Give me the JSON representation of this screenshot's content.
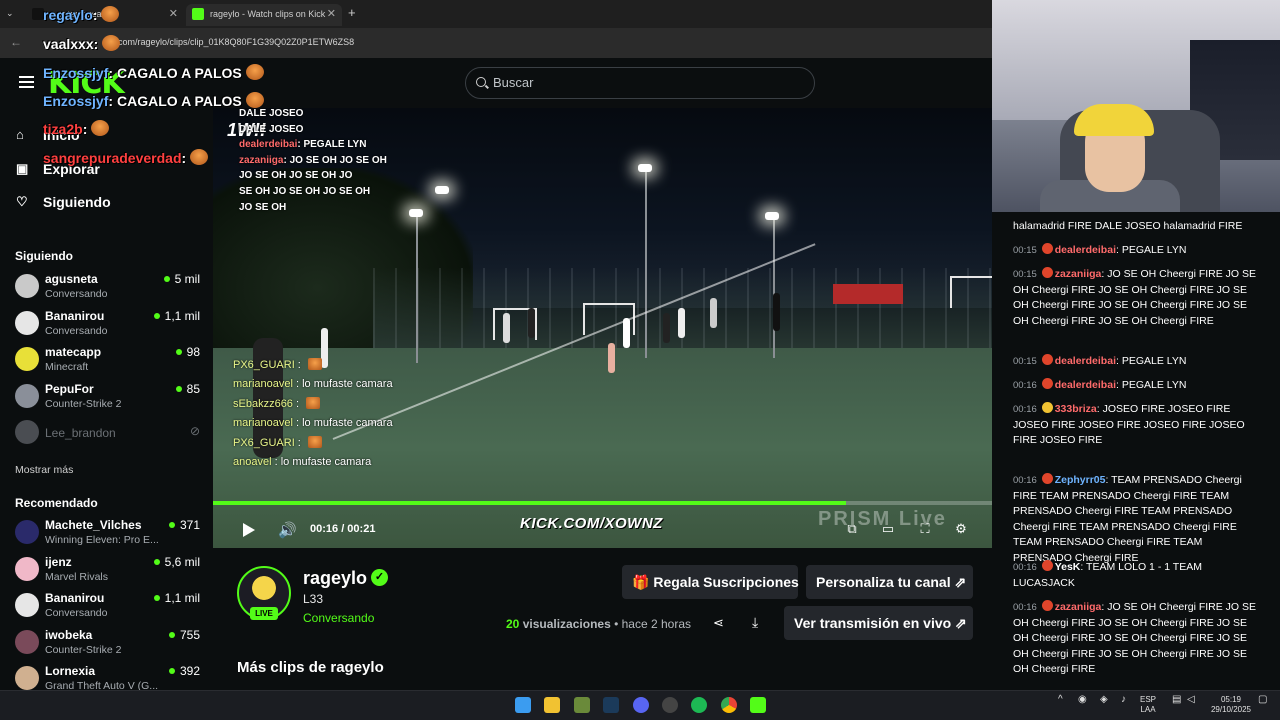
{
  "browser": {
    "tabs": [
      {
        "label": "...antes pesad",
        "active": false
      },
      {
        "label": "rageylo - Watch clips on Kick",
        "active": true
      }
    ],
    "new_tab": "+",
    "url": "com/rageylo/clips/clip_01K8Q80F1G39Q02Z0P1ETW6ZS8"
  },
  "header": {
    "logo": "KICK",
    "search_placeholder": "Buscar"
  },
  "overlay_chat": [
    {
      "user": "regaylo",
      "text": "",
      "color": "#6fb4ff"
    },
    {
      "user": "vaalxxx",
      "text": "",
      "color": "#ffffff"
    },
    {
      "user": "Enzossjyf",
      "text": "CAGALO A PALOS",
      "color": "#6fb4ff"
    },
    {
      "user": "Enzossjyf",
      "text": "CAGALO A PALOS",
      "color": "#6fb4ff"
    },
    {
      "user": "tiza2b",
      "text": "",
      "color": "#ff4040"
    },
    {
      "user": "sangrepuradeverdad",
      "text": "",
      "color": "#ff4040"
    }
  ],
  "sidebar": {
    "nav": [
      {
        "label": "Inicio",
        "icon": "home-icon"
      },
      {
        "label": "Explorar",
        "icon": "compass-icon"
      },
      {
        "label": "Siguiendo",
        "icon": "heart-icon"
      }
    ],
    "following_title": "Siguiendo",
    "following": [
      {
        "name": "agusneta",
        "game": "Conversando",
        "viewers": "5 mil",
        "avatar_color": "#c9c9c9"
      },
      {
        "name": "Bananirou",
        "game": "Conversando",
        "viewers": "1,1 mil",
        "avatar_color": "#e6e6e6"
      },
      {
        "name": "matecapp",
        "game": "Minecraft",
        "viewers": "98",
        "avatar_color": "#e8e038"
      },
      {
        "name": "PepuFor",
        "game": "Counter-Strike 2",
        "viewers": "85",
        "avatar_color": "#8a8f99"
      },
      {
        "name": "Lee_brandon",
        "game": "",
        "viewers": "",
        "avatar_color": "#4a4d52",
        "offline": true
      }
    ],
    "show_more": "Mostrar más",
    "recommended_title": "Recomendado",
    "recommended": [
      {
        "name": "Machete_Vilches",
        "game": "Winning Eleven: Pro E...",
        "viewers": "371",
        "avatar_color": "#2a2a6a"
      },
      {
        "name": "ijenz",
        "game": "Marvel Rivals",
        "viewers": "5,6 mil",
        "avatar_color": "#f0b8c8"
      },
      {
        "name": "Bananirou",
        "game": "Conversando",
        "viewers": "1,1 mil",
        "avatar_color": "#e6e6e6"
      },
      {
        "name": "iwobeka",
        "game": "Counter-Strike 2",
        "viewers": "755",
        "avatar_color": "#7a4a5a"
      },
      {
        "name": "Lornexia",
        "game": "Grand Theft Auto V (G...",
        "viewers": "392",
        "avatar_color": "#d0b090"
      }
    ]
  },
  "video": {
    "time": "00:16 / 00:21",
    "progress": 0.813,
    "watermark": "KICK.COM/XOWNZ",
    "prism": "PRISM Live",
    "stream_chat_top": [
      {
        "user": "",
        "text": "DALE JOSEO"
      },
      {
        "user": "",
        "text": "DALE JOSEO"
      },
      {
        "user": "dealerdeibai",
        "text": "PEGALE LYN"
      },
      {
        "user": "zazaniiga",
        "text": "JO SE OH   JO SE OH"
      },
      {
        "user": "",
        "text": "JO SE OH   JO SE OH   JO"
      },
      {
        "user": "",
        "text": "SE OH   JO SE OH   JO SE OH"
      },
      {
        "user": "",
        "text": "JO SE OH"
      }
    ],
    "stream_chat_bottom": [
      {
        "user": "PX6_GUARI",
        "text": ""
      },
      {
        "user": "marianoavel",
        "text": "lo mufaste camara"
      },
      {
        "user": "sEbakzz666",
        "text": ""
      },
      {
        "user": "marianoavel",
        "text": "lo mufaste camara"
      },
      {
        "user": "PX6_GUARI",
        "text": ""
      },
      {
        "user": "anoavel",
        "text": "lo mufaste camara"
      }
    ]
  },
  "clip": {
    "channel": "rageylo",
    "live_badge": "LIVE",
    "title": "L33",
    "category": "Conversando",
    "views_count": "20",
    "views_label": "visualizaciones",
    "time_ago": "• hace 2 horas",
    "btn_gift": "Regala Suscripciones",
    "btn_customize": "Personaliza tu canal",
    "btn_watch_live": "Ver transmisión en vivo",
    "more_clips": "Más clips de rageylo"
  },
  "chat": [
    {
      "time": "",
      "user": "",
      "text": "halamadrid FIRE DALE JOSEO halamadrid FIRE",
      "ucolor": "#ffffff"
    },
    {
      "time": "00:15",
      "user": "dealerdeibai",
      "text": "PEGALE LYN",
      "ucolor": "#ff6b6b"
    },
    {
      "time": "00:15",
      "user": "zazaniiga",
      "text": "JO SE OH Cheergi FIRE JO SE OH Cheergi FIRE JO SE OH Cheergi FIRE JO SE OH Cheergi FIRE JO SE OH Cheergi FIRE JO SE OH Cheergi FIRE JO SE OH Cheergi FIRE",
      "ucolor": "#ff6b6b"
    },
    {
      "time": "00:15",
      "user": "dealerdeibai",
      "text": "PEGALE LYN",
      "ucolor": "#ff6b6b"
    },
    {
      "time": "00:16",
      "user": "dealerdeibai",
      "text": "PEGALE LYN",
      "ucolor": "#ff6b6b"
    },
    {
      "time": "00:16",
      "user": "333briza",
      "text": "JOSEO   FIRE JOSEO   FIRE JOSEO   FIRE JOSEO   FIRE JOSEO   FIRE JOSEO   FIRE JOSEO   FIRE",
      "ucolor": "#ff6b6b"
    },
    {
      "time": "00:16",
      "user": "Zephyrr05",
      "text": "TEAM PRENSADO Cheergi FIRE TEAM PRENSADO Cheergi FIRE TEAM PRENSADO Cheergi FIRE TEAM PRENSADO Cheergi FIRE TEAM PRENSADO Cheergi FIRE TEAM PRENSADO Cheergi FIRE TEAM PRENSADO Cheergi FIRE",
      "ucolor": "#6fb4ff"
    },
    {
      "time": "00:16",
      "user": "YesK",
      "text": "TEAM LOLO 1 - 1 TEAM LUCASJACK",
      "ucolor": "#ffffff"
    },
    {
      "time": "00:16",
      "user": "zazaniiga",
      "text": "JO SE OH Cheergi FIRE JO SE OH Cheergi FIRE JO SE OH Cheergi FIRE JO SE OH Cheergi FIRE JO SE OH Cheergi FIRE JO SE OH Cheergi FIRE JO SE OH Cheergi FIRE JO SE OH Cheergi FIRE",
      "ucolor": "#ff6b6b"
    }
  ],
  "taskbar": {
    "lang": "ESP\nLAA",
    "time": "05:19",
    "date": "29/10/2025"
  },
  "colors": {
    "accent": "#53fc18",
    "bg": "#0b0e0f"
  }
}
